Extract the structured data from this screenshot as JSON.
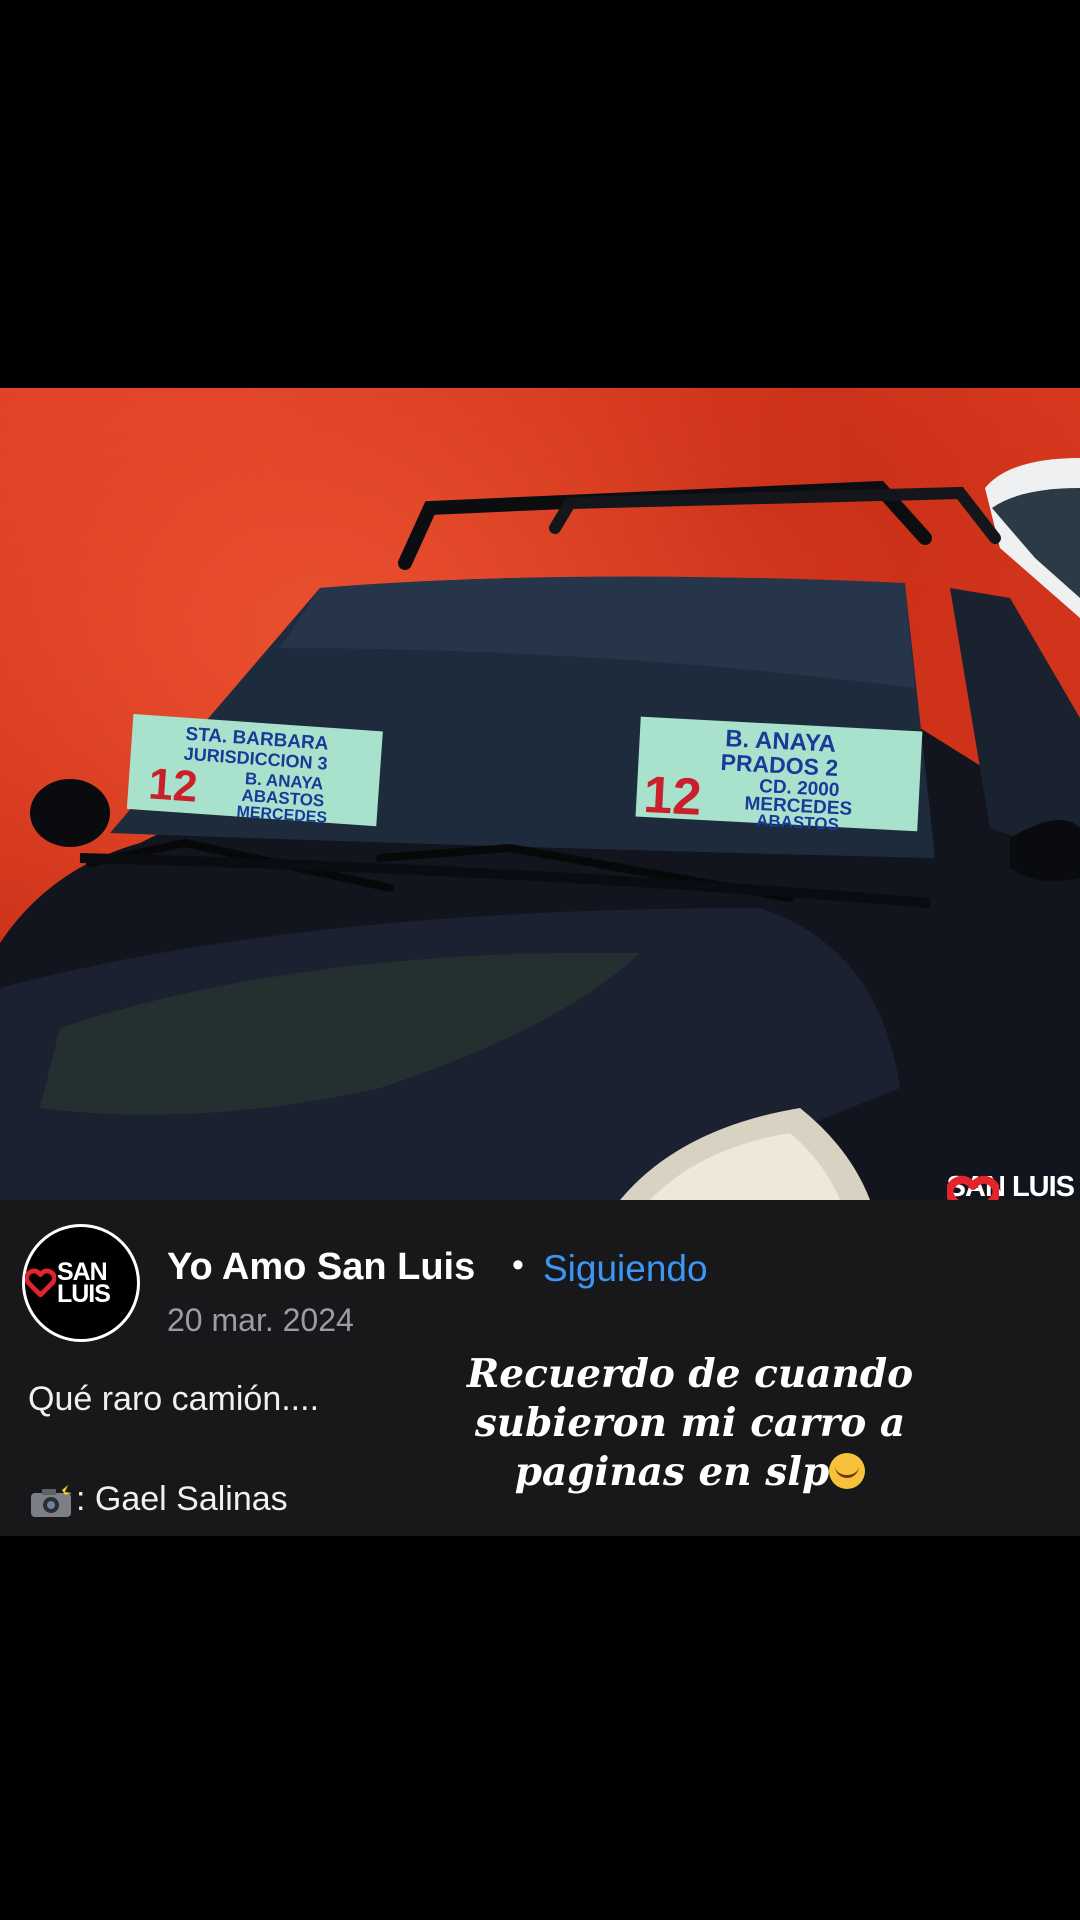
{
  "post": {
    "page_name": "Yo Amo San Luis",
    "separator": "•",
    "follow_label": "Siguiendo",
    "date": "20 mar. 2024",
    "caption": "Qué raro camión....",
    "credit": ": Gael Salinas",
    "overlay_text": "Recuerdo de cuando subieron mi carro a paginas en slp",
    "avatar_brand": "SAN LUIS"
  },
  "photo": {
    "watermark": "SAN LUIS",
    "sign_left": [
      "STA. BARBARA",
      "JURISDICCION 3",
      "B. ANAYA",
      "ABASTOS",
      "MERCEDES"
    ],
    "sign_left_number": "12",
    "sign_right": [
      "B. ANAYA",
      "PRADOS 2",
      "CD. 2000",
      "MERCEDES",
      "ABASTOS"
    ],
    "sign_right_number": "12"
  },
  "colors": {
    "background": "#000000",
    "post_background": "#18181a",
    "follow_blue": "#3d96f5",
    "date_grey": "#9c9ca2",
    "wall_red": "#d83a22",
    "brand_red": "#e3242b"
  },
  "icons": [
    "heart-logo-icon",
    "camera-flash-icon",
    "laughing-face-icon"
  ]
}
